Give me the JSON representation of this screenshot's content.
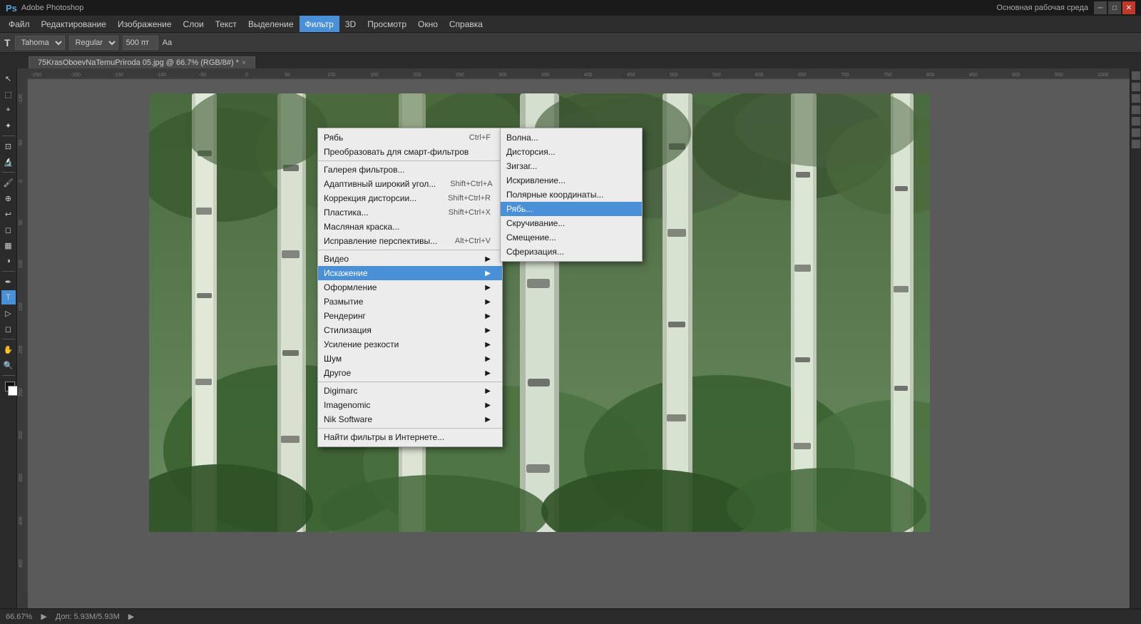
{
  "app": {
    "title": "Adobe Photoshop",
    "ps_icon": "Ps",
    "workspace": "Основная рабочая среда"
  },
  "title_bar": {
    "minimize": "─",
    "maximize": "□",
    "close": "✕"
  },
  "menu_bar": {
    "items": [
      {
        "label": "Файл",
        "id": "file"
      },
      {
        "label": "Редактирование",
        "id": "edit"
      },
      {
        "label": "Изображение",
        "id": "image"
      },
      {
        "label": "Слои",
        "id": "layers"
      },
      {
        "label": "Текст",
        "id": "text"
      },
      {
        "label": "Выделение",
        "id": "select"
      },
      {
        "label": "Фильтр",
        "id": "filter",
        "active": true
      },
      {
        "label": "3D",
        "id": "3d"
      },
      {
        "label": "Просмотр",
        "id": "view"
      },
      {
        "label": "Окно",
        "id": "window"
      },
      {
        "label": "Справка",
        "id": "help"
      }
    ]
  },
  "options_bar": {
    "tool_icon": "T",
    "font_name": "Tahoma",
    "font_style": "Regular",
    "font_size": "500 пт",
    "aa_label": "Аа"
  },
  "doc_tab": {
    "title": "75KrasOboevNaTemuPriroda 05.jpg @ 66.7% (RGB/8#) *",
    "close": "×"
  },
  "filter_menu": {
    "items": [
      {
        "label": "Рябь",
        "shortcut": "Ctrl+F",
        "type": "item",
        "id": "ripple-top"
      },
      {
        "label": "Преобразовать для смарт-фильтров",
        "shortcut": "",
        "type": "item",
        "id": "smart-filters"
      },
      {
        "label": "sep1",
        "type": "separator"
      },
      {
        "label": "Галерея фильтров...",
        "shortcut": "",
        "type": "item",
        "id": "filter-gallery"
      },
      {
        "label": "Адаптивный широкий угол...",
        "shortcut": "Shift+Ctrl+A",
        "type": "item",
        "id": "adaptive-wide"
      },
      {
        "label": "Коррекция дисторсии...",
        "shortcut": "Shift+Ctrl+R",
        "type": "item",
        "id": "distortion"
      },
      {
        "label": "Пластика...",
        "shortcut": "Shift+Ctrl+X",
        "type": "item",
        "id": "liquify"
      },
      {
        "label": "Масляная краска...",
        "shortcut": "",
        "type": "item",
        "id": "oil-paint"
      },
      {
        "label": "Исправление перспективы...",
        "shortcut": "Alt+Ctrl+V",
        "type": "item",
        "id": "perspective"
      },
      {
        "label": "sep2",
        "type": "separator"
      },
      {
        "label": "Видео",
        "shortcut": "",
        "type": "submenu",
        "id": "video"
      },
      {
        "label": "Искажение",
        "shortcut": "",
        "type": "submenu",
        "id": "distort",
        "active": true
      },
      {
        "label": "Оформление",
        "shortcut": "",
        "type": "submenu",
        "id": "design"
      },
      {
        "label": "Размытие",
        "shortcut": "",
        "type": "submenu",
        "id": "blur"
      },
      {
        "label": "Рендеринг",
        "shortcut": "",
        "type": "submenu",
        "id": "render"
      },
      {
        "label": "Стилизация",
        "shortcut": "",
        "type": "submenu",
        "id": "stylize"
      },
      {
        "label": "Усиление резкости",
        "shortcut": "",
        "type": "submenu",
        "id": "sharpen"
      },
      {
        "label": "Шум",
        "shortcut": "",
        "type": "submenu",
        "id": "noise"
      },
      {
        "label": "Другое",
        "shortcut": "",
        "type": "submenu",
        "id": "other"
      },
      {
        "label": "sep3",
        "type": "separator"
      },
      {
        "label": "Digimarc",
        "shortcut": "",
        "type": "submenu",
        "id": "digimarc"
      },
      {
        "label": "Imagenomic",
        "shortcut": "",
        "type": "submenu",
        "id": "imagenomic"
      },
      {
        "label": "Nik Software",
        "shortcut": "",
        "type": "submenu",
        "id": "nik-software"
      },
      {
        "label": "sep4",
        "type": "separator"
      },
      {
        "label": "Найти фильтры в Интернете...",
        "shortcut": "",
        "type": "item",
        "id": "find-filters"
      }
    ]
  },
  "distort_submenu": {
    "items": [
      {
        "label": "Волна...",
        "id": "wave"
      },
      {
        "label": "Дисторсия...",
        "id": "distortion-sub"
      },
      {
        "label": "Зигзаг...",
        "id": "zigzag"
      },
      {
        "label": "Искривление...",
        "id": "warp"
      },
      {
        "label": "Полярные координаты...",
        "id": "polar"
      },
      {
        "label": "Рябь...",
        "id": "ripple",
        "active": true
      },
      {
        "label": "Скручивание...",
        "id": "twirl"
      },
      {
        "label": "Смещение...",
        "id": "shift"
      },
      {
        "label": "Сферизация...",
        "id": "spherize"
      }
    ]
  },
  "status_bar": {
    "zoom": "66.67%",
    "info": "Доп: 5.93M/5.93M"
  },
  "colors": {
    "accent_blue": "#4a90d9",
    "menu_bg": "#ececec",
    "active_highlight": "#4a90d9",
    "app_bg": "#3c3c3c"
  }
}
